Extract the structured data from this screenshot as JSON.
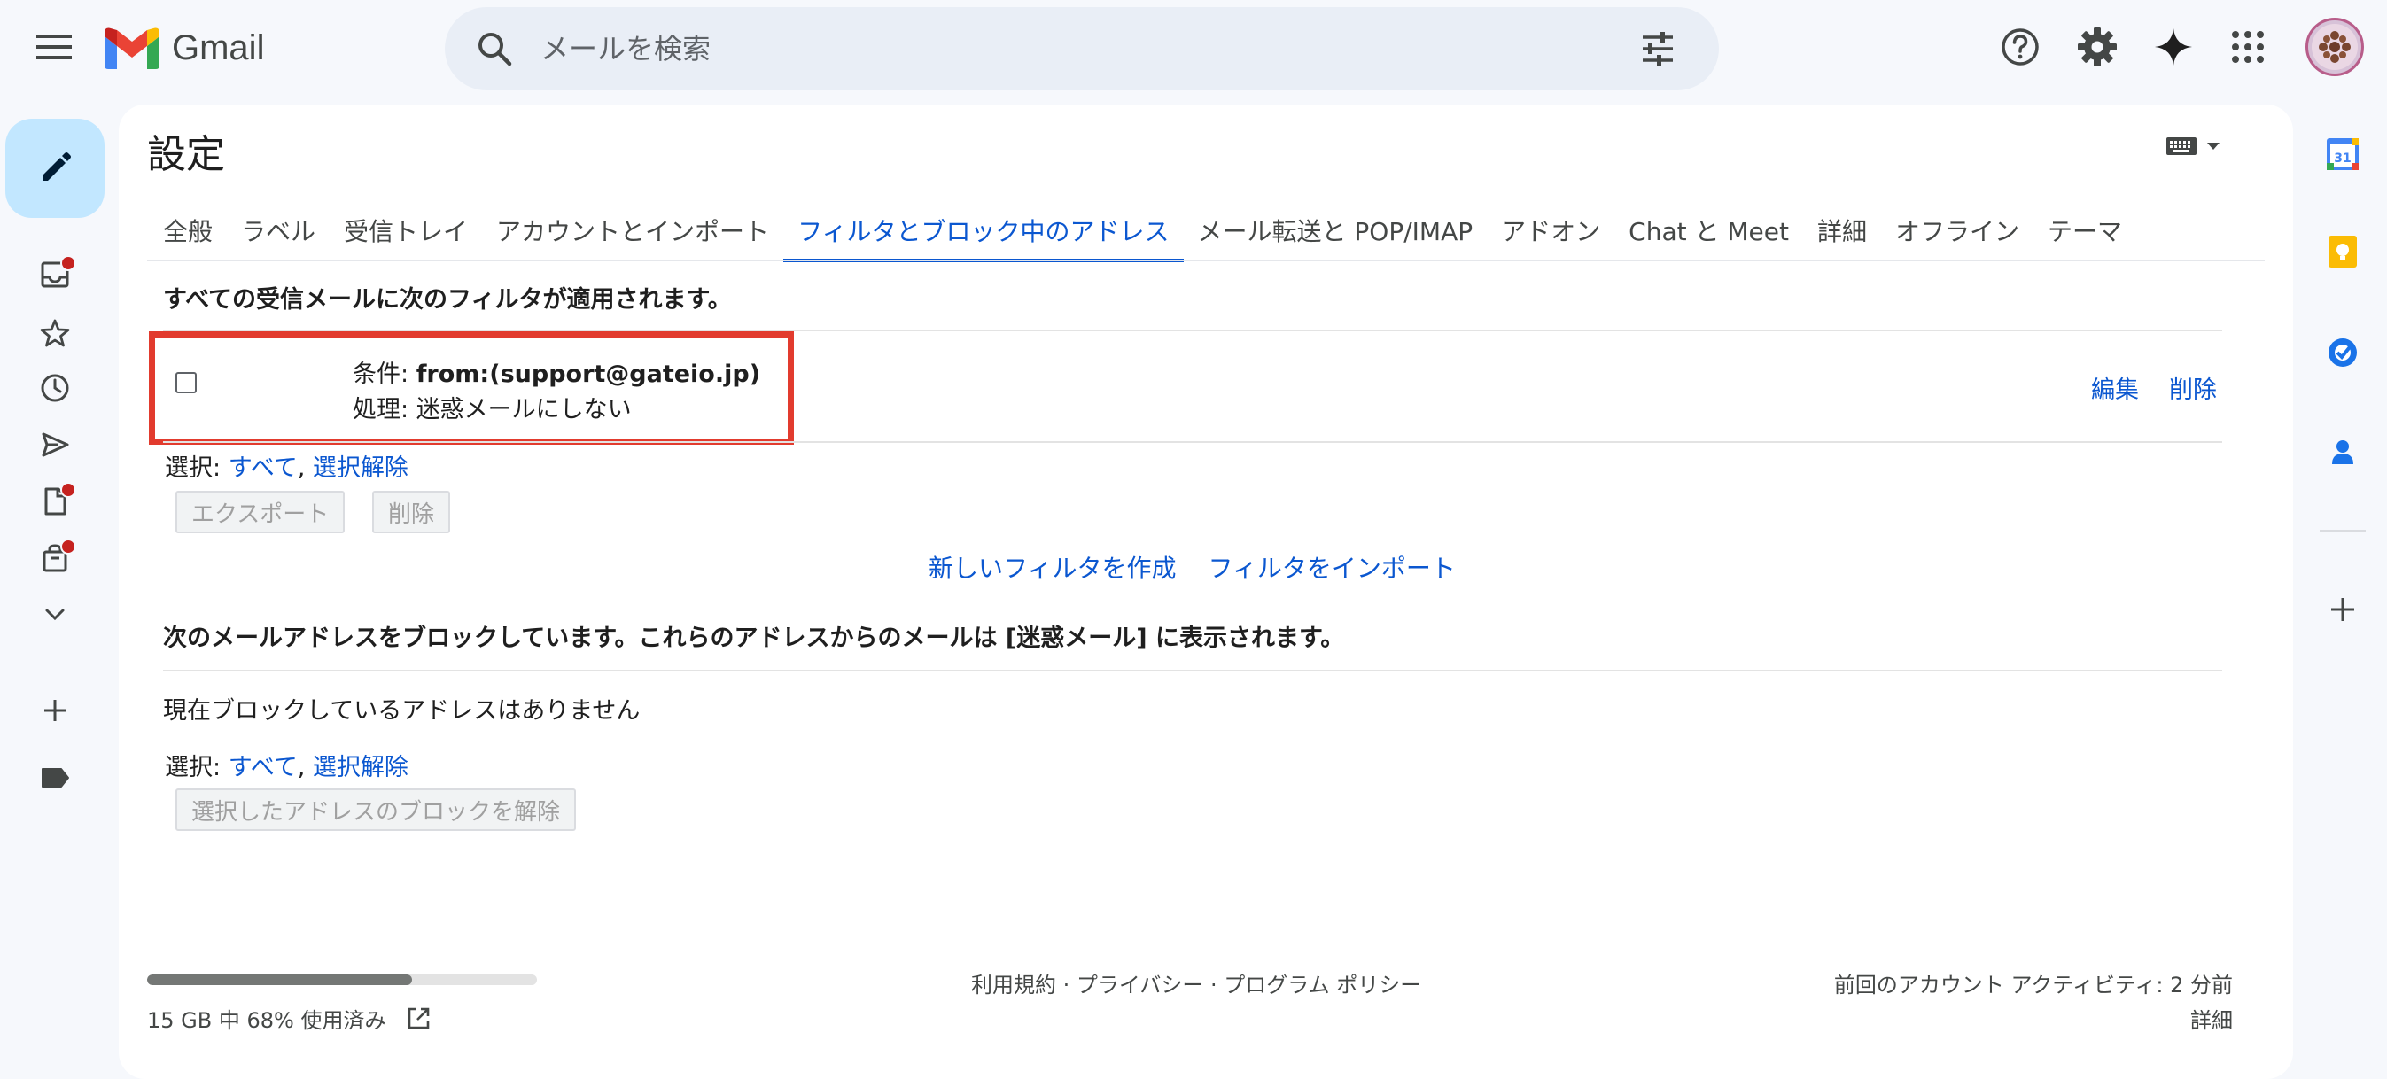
{
  "header": {
    "app_name": "Gmail",
    "search_placeholder": "メールを検索"
  },
  "settings": {
    "title": "設定",
    "tabs": [
      {
        "label": "全般"
      },
      {
        "label": "ラベル"
      },
      {
        "label": "受信トレイ"
      },
      {
        "label": "アカウントとインポート"
      },
      {
        "label": "フィルタとブロック中のアドレス",
        "active": true
      },
      {
        "label": "メール転送と POP/IMAP"
      },
      {
        "label": "アドオン"
      },
      {
        "label": "Chat と Meet"
      },
      {
        "label": "詳細"
      },
      {
        "label": "オフライン"
      },
      {
        "label": "テーマ"
      }
    ],
    "filters": {
      "heading": "すべての受信メールに次のフィルタが適用されます。",
      "item": {
        "condition_prefix": "条件: ",
        "condition_value": "from:(support@gateio.jp)",
        "action_prefix": "処理: ",
        "action_value": "迷惑メールにしない",
        "edit_label": "編集",
        "delete_label": "削除"
      },
      "select_prefix": "選択: ",
      "select_all": "すべて",
      "select_sep": ", ",
      "select_none": "選択解除",
      "export_button": "エクスポート",
      "delete_button": "削除",
      "create_filter": "新しいフィルタを作成",
      "import_filters": "フィルタをインポート"
    },
    "blocked": {
      "heading": "次のメールアドレスをブロックしています。これらのアドレスからのメールは [迷惑メール] に表示されます。",
      "empty_text": "現在ブロックしているアドレスはありません",
      "select_prefix": "選択: ",
      "select_all": "すべて",
      "select_sep": ", ",
      "select_none": "選択解除",
      "unblock_button": "選択したアドレスのブロックを解除"
    }
  },
  "footer": {
    "storage_text": "15 GB 中 68% 使用済み",
    "storage_fraction": 0.68,
    "links": "利用規約 · プライバシー · プログラム ポリシー",
    "last_activity": "前回のアカウント アクティビティ: 2 分前",
    "details": "詳細"
  },
  "colors": {
    "accent": "#0b57d0",
    "highlight_border": "#e23b2e",
    "notification_dot": "#c5221f",
    "compose_bg": "#c2e7ff"
  },
  "icons": {
    "header": [
      "menu-icon",
      "gmail-logo",
      "search-icon",
      "tune-icon",
      "help-icon",
      "gear-icon",
      "gemini-icon",
      "apps-grid-icon"
    ],
    "left_rail": [
      "pencil-icon",
      "inbox-icon",
      "star-icon",
      "clock-icon",
      "send-icon",
      "draft-icon",
      "bag-icon",
      "chevron-down-icon",
      "plus-icon",
      "label-icon"
    ],
    "right_rail": [
      "calendar-icon",
      "keep-icon",
      "tasks-icon",
      "contacts-icon",
      "plus-icon"
    ]
  },
  "calendar_badge": "31"
}
